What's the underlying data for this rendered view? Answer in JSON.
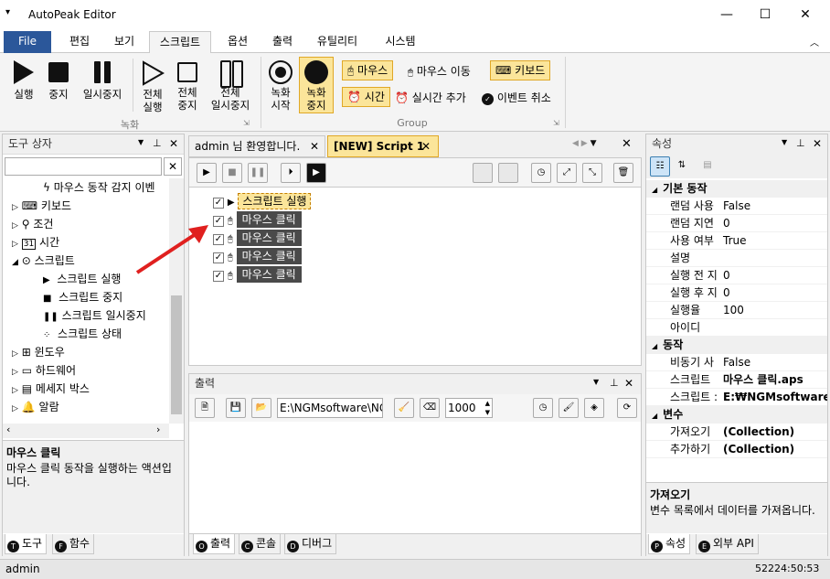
{
  "window": {
    "title": "AutoPeak Editor",
    "min": "—",
    "max": "☐",
    "close": "✕"
  },
  "menu": {
    "file": "File",
    "tabs": [
      "편집",
      "보기",
      "스크립트",
      "옵션",
      "출력",
      "유틸리티",
      "시스템"
    ]
  },
  "ribbon": {
    "record_group": "녹화",
    "group2": "Group",
    "run": "실행",
    "stop": "중지",
    "pause": "일시중지",
    "run_all": [
      "전체",
      "실행"
    ],
    "stop_all": [
      "전체",
      "중지"
    ],
    "pause_all": [
      "전체",
      "일시중지"
    ],
    "rec_start": [
      "녹화",
      "시작"
    ],
    "rec_stop": [
      "녹화",
      "중지"
    ],
    "mouse": "마우스",
    "mouse_move": "마우스 이동",
    "keyboard": "키보드",
    "time": "시간",
    "realtime_add": "실시간 추가",
    "event_cancel": "이벤트 취소"
  },
  "toolbox": {
    "title": "도구 상자",
    "search_placeholder": "",
    "items": [
      {
        "label": "마우스 동작 감지 이벤",
        "indent": 2
      },
      {
        "label": "키보드",
        "indent": 1,
        "exp": "▷"
      },
      {
        "label": "조건",
        "indent": 1,
        "exp": "▷"
      },
      {
        "label": "시간",
        "indent": 1,
        "exp": "▷"
      },
      {
        "label": "스크립트",
        "indent": 1,
        "exp": "◢"
      },
      {
        "label": "스크립트 실행",
        "indent": 2
      },
      {
        "label": "스크립트 중지",
        "indent": 2
      },
      {
        "label": "스크립트 일시중지",
        "indent": 2
      },
      {
        "label": "스크립트 상태",
        "indent": 2
      },
      {
        "label": "윈도우",
        "indent": 1,
        "exp": "▷"
      },
      {
        "label": "하드웨어",
        "indent": 1,
        "exp": "▷"
      },
      {
        "label": "메세지 박스",
        "indent": 1,
        "exp": "▷"
      },
      {
        "label": "알람",
        "indent": 1,
        "exp": "▷"
      }
    ],
    "desc_title": "마우스 클릭",
    "desc_text": "마우스 클릭 동작을 실행하는 액션입니다.",
    "tabs": [
      {
        "icon": "T",
        "label": "도구"
      },
      {
        "icon": "F",
        "label": "함수"
      }
    ]
  },
  "editor": {
    "tabs": [
      "admin 님 환영합니다.",
      "[NEW] Script 1"
    ],
    "rows": [
      "스크립트 실행",
      "마우스 클릭",
      "마우스 클릭",
      "마우스 클릭",
      "마우스 클릭"
    ]
  },
  "output": {
    "title": "출력",
    "path": "E:\\NGMsoftware\\NG",
    "interval": "1000",
    "tabs": [
      {
        "icon": "O",
        "label": "출력"
      },
      {
        "icon": "C",
        "label": "콘솔"
      },
      {
        "icon": "D",
        "label": "디버그"
      }
    ]
  },
  "properties": {
    "title": "속성",
    "sections": [
      {
        "name": "기본 동작",
        "rows": [
          [
            "랜덤 사용",
            "False"
          ],
          [
            "랜덤 지연",
            "0"
          ],
          [
            "사용 여부",
            "True"
          ],
          [
            "설명",
            ""
          ],
          [
            "실행 전 지",
            "0"
          ],
          [
            "실행 후 지",
            "0"
          ],
          [
            "실행율",
            "100"
          ],
          [
            "아이디",
            ""
          ]
        ]
      },
      {
        "name": "동작",
        "rows": [
          [
            "비동기 사",
            "False"
          ],
          [
            "스크립트",
            "마우스 클릭.aps"
          ],
          [
            "스크립트 :",
            "E:₩NGMsoftware₩"
          ]
        ]
      },
      {
        "name": "변수",
        "rows": [
          [
            "가져오기",
            "(Collection)"
          ],
          [
            "추가하기",
            "(Collection)"
          ]
        ]
      }
    ],
    "desc_title": "가져오기",
    "desc_text": "변수 목록에서 데이터를 가져옵니다.",
    "tabs": [
      {
        "icon": "P",
        "label": "속성"
      },
      {
        "icon": "E",
        "label": "외부 API"
      }
    ]
  },
  "status": {
    "user": "admin",
    "time": "52224:50:53"
  }
}
